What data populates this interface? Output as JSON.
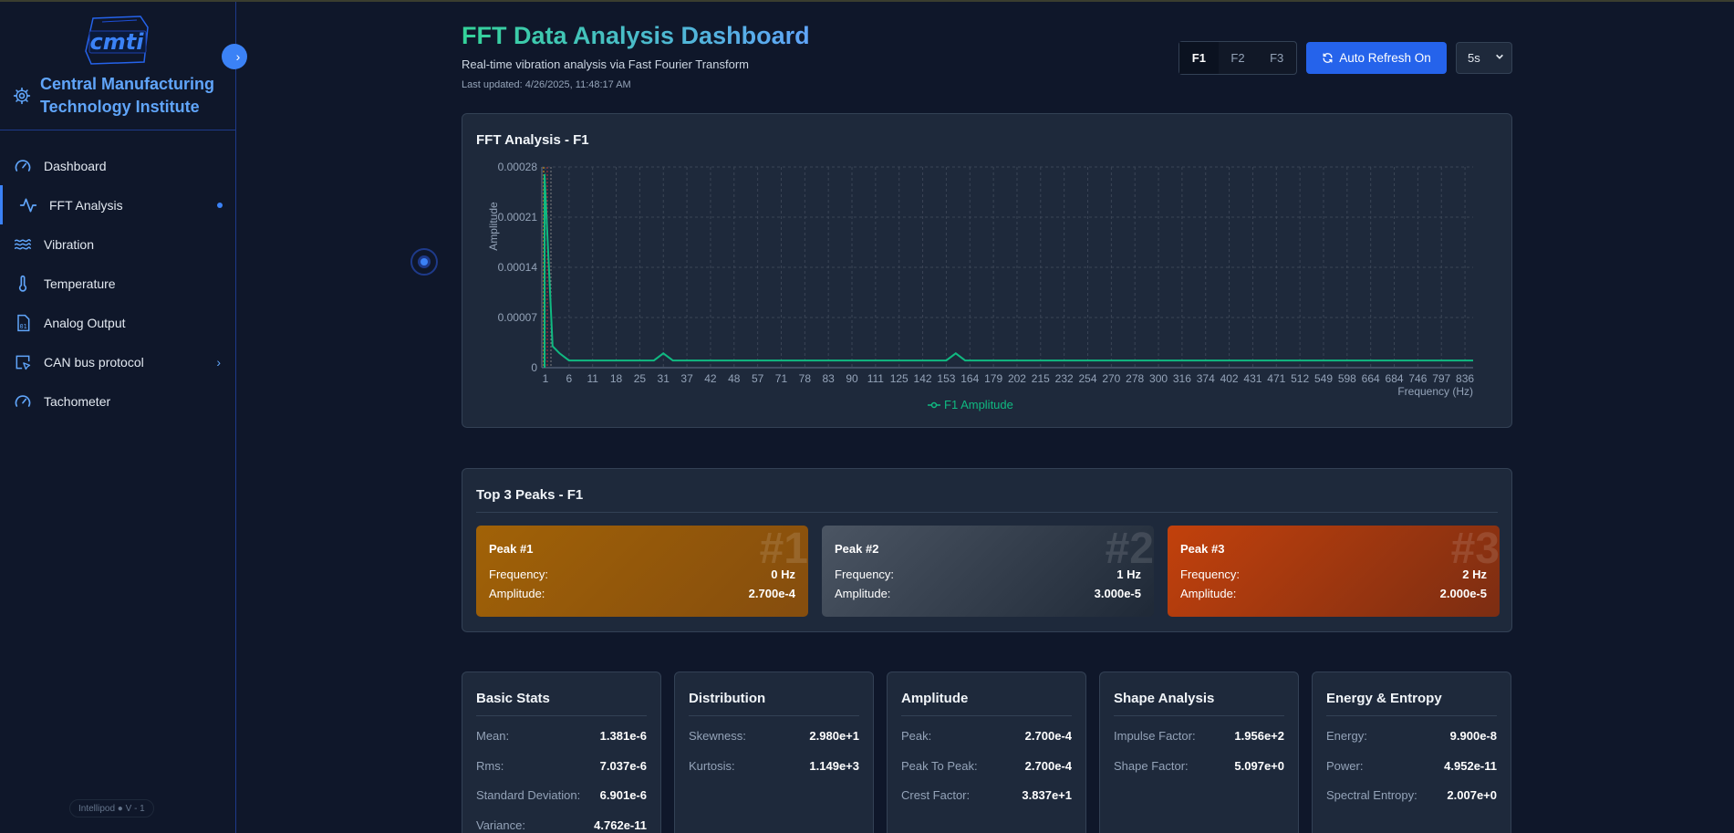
{
  "sidebar": {
    "logo_text": "cmti",
    "brand": "Central Manufacturing Technology Institute",
    "items": [
      {
        "label": "Dashboard",
        "icon": "gauge-icon"
      },
      {
        "label": "FFT Analysis",
        "icon": "activity-icon",
        "active": true
      },
      {
        "label": "Vibration",
        "icon": "waves-icon"
      },
      {
        "label": "Temperature",
        "icon": "thermometer-icon"
      },
      {
        "label": "Analog Output",
        "icon": "file-binary-icon"
      },
      {
        "label": "CAN bus protocol",
        "icon": "cursor-square-icon",
        "has_submenu": true
      },
      {
        "label": "Tachometer",
        "icon": "gauge-icon"
      }
    ],
    "version": "Intellipod ● V - 1"
  },
  "header": {
    "title": "FFT Data Analysis Dashboard",
    "subtitle": "Real-time vibration analysis via Fast Fourier Transform",
    "last_updated": "Last updated: 4/26/2025, 11:48:17 AM",
    "tabs": [
      "F1",
      "F2",
      "F3"
    ],
    "active_tab": "F1",
    "refresh_label": "Auto Refresh On",
    "interval": "5s"
  },
  "chart_card": {
    "title": "FFT Analysis - F1"
  },
  "chart_data": {
    "type": "line",
    "title": "FFT Analysis - F1",
    "xlabel": "Frequency (Hz)",
    "ylabel": "Amplitude",
    "ylim": [
      0,
      0.00028
    ],
    "y_ticks": [
      "0",
      "0.00007",
      "0.00014",
      "0.00021",
      "0.00028"
    ],
    "x_ticks": [
      "1",
      "6",
      "11",
      "18",
      "25",
      "31",
      "37",
      "42",
      "48",
      "57",
      "71",
      "78",
      "83",
      "90",
      "111",
      "125",
      "142",
      "153",
      "164",
      "179",
      "202",
      "215",
      "232",
      "254",
      "270",
      "278",
      "300",
      "316",
      "374",
      "402",
      "431",
      "471",
      "512",
      "549",
      "598",
      "664",
      "684",
      "746",
      "797",
      "836"
    ],
    "grid": true,
    "legend": "bottom-center",
    "series": [
      {
        "name": "F1 Amplitude",
        "color": "#10b981",
        "x": [
          0,
          1,
          2,
          3,
          9,
          10,
          11,
          12,
          13,
          37,
          38,
          39,
          40,
          41,
          836
        ],
        "y": [
          0.00027,
          3e-05,
          2e-05,
          1e-05,
          1e-05,
          1e-05,
          2e-05,
          1e-05,
          1e-05,
          1e-05,
          1e-05,
          2e-05,
          1e-05,
          1e-05,
          1e-05
        ],
        "index": [
          0,
          0.3,
          0.6,
          1,
          4.2,
          4.6,
          5,
          5.4,
          5.8,
          16.6,
          17,
          17.4,
          17.8,
          18.2,
          39
        ]
      }
    ]
  },
  "peaks": {
    "title": "Top 3 Peaks - F1",
    "freq_label": "Frequency:",
    "amp_label": "Amplitude:",
    "items": [
      {
        "rank": "#1",
        "title": "Peak #1",
        "frequency": "0 Hz",
        "amplitude": "2.700e-4"
      },
      {
        "rank": "#2",
        "title": "Peak #2",
        "frequency": "1 Hz",
        "amplitude": "3.000e-5"
      },
      {
        "rank": "#3",
        "title": "Peak #3",
        "frequency": "2 Hz",
        "amplitude": "2.000e-5"
      }
    ]
  },
  "stats": [
    {
      "title": "Basic Stats",
      "rows": [
        {
          "k": "Mean:",
          "v": "1.381e-6"
        },
        {
          "k": "Rms:",
          "v": "7.037e-6"
        },
        {
          "k": "Standard Deviation:",
          "v": "6.901e-6"
        },
        {
          "k": "Variance:",
          "v": "4.762e-11"
        }
      ]
    },
    {
      "title": "Distribution",
      "rows": [
        {
          "k": "Skewness:",
          "v": "2.980e+1"
        },
        {
          "k": "Kurtosis:",
          "v": "1.149e+3"
        }
      ]
    },
    {
      "title": "Amplitude",
      "rows": [
        {
          "k": "Peak:",
          "v": "2.700e-4"
        },
        {
          "k": "Peak To Peak:",
          "v": "2.700e-4"
        },
        {
          "k": "Crest Factor:",
          "v": "3.837e+1"
        }
      ]
    },
    {
      "title": "Shape Analysis",
      "rows": [
        {
          "k": "Impulse Factor:",
          "v": "1.956e+2"
        },
        {
          "k": "Shape Factor:",
          "v": "5.097e+0"
        }
      ]
    },
    {
      "title": "Energy & Entropy",
      "rows": [
        {
          "k": "Energy:",
          "v": "9.900e-8"
        },
        {
          "k": "Power:",
          "v": "4.952e-11"
        },
        {
          "k": "Spectral Entropy:",
          "v": "2.007e+0"
        }
      ]
    }
  ]
}
